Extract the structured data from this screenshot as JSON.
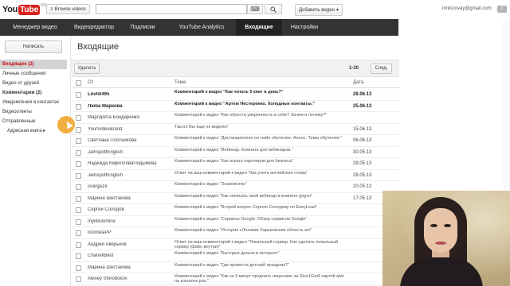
{
  "masthead": {
    "logo_you": "You",
    "logo_tube": "Tube",
    "logo_region": "RU",
    "browse_label": "Browse videos",
    "search_placeholder": "",
    "upload_label": "Добавить видео",
    "username": "irinlozovay@gmail.com",
    "notification_count": "2"
  },
  "nav": {
    "tabs": [
      {
        "label": "Менеджер видео",
        "active": false
      },
      {
        "label": "Видеоредактор",
        "active": false
      },
      {
        "label": "Подписки",
        "active": false
      },
      {
        "label": "YouTube Analytics",
        "active": false
      },
      {
        "label": "Входящие",
        "active": true
      },
      {
        "label": "Настройки",
        "active": false
      }
    ]
  },
  "sidebar": {
    "compose_label": "Написать",
    "items": [
      {
        "label": "Входящие (2)",
        "state": "active"
      },
      {
        "label": "Личные сообщения",
        "state": ""
      },
      {
        "label": "Видео от друзей",
        "state": ""
      },
      {
        "label": "Комментарии (2)",
        "state": "bold"
      },
      {
        "label": "Уведомления в контактах",
        "state": ""
      },
      {
        "label": "Видеоответы",
        "state": ""
      },
      {
        "label": "Отправленные",
        "state": ""
      },
      {
        "label": "Адресная книга ▸",
        "state": "sub"
      }
    ]
  },
  "main": {
    "title": "Входящие",
    "delete_label": "Удалить",
    "range": "1-20",
    "next_label": "След.",
    "columns": {
      "from": "От",
      "subject": "Тема",
      "date": "Дата"
    },
    "rows": [
      {
        "from": "Lovlili495",
        "subject": "Комментарий к видео \"Как читать 5 книг в день?\"",
        "date": "28.06.13",
        "unread": true
      },
      {
        "from": "Люба Маркова",
        "subject": "Комментарий к видео \"Артем Нестеренко. Холодные контакты.\"",
        "date": "25.06.13",
        "unread": true
      },
      {
        "from": "Маргарита Бондаренко",
        "subject": "Комментарий к видео \"Как обрести уверенность в себе? Зачем и почему?\"",
        "date": "",
        "unread": false
      },
      {
        "from": "YourVideoBrand",
        "subject": "Такого Вы еще не видели!",
        "date": "15.06.13",
        "unread": false
      },
      {
        "from": "Светлана Плотникова",
        "subject": "Комментарий к видео \"Дистанционное он-лайн обучение. Анонс. Темы обучения.\"",
        "date": "06.06.13",
        "unread": false
      },
      {
        "from": "JamspottEnglish",
        "subject": "Комментарий к видео \"Вебинар. Комната для вебинаров.\"",
        "date": "30.05.13",
        "unread": false
      },
      {
        "from": "Надежда КирилловаПодымова",
        "subject": "Комментарий к видео \"Как искать партнеров для бизнеса\"",
        "date": "29.05.13",
        "unread": false
      },
      {
        "from": "JamspottEnglish",
        "subject": "Ответ на ваш комментарий к видео \"Как учить английские слова\"",
        "date": "28.05.13",
        "unread": false
      },
      {
        "from": "svarga16",
        "subject": "Комментарий к видео \"Знакомство\"",
        "date": "20.05.13",
        "unread": false
      },
      {
        "from": "Марина Шестакова",
        "subject": "Комментарий к видео \"Как записать свой вебинар в комнате gogvo\"",
        "date": "17.05.13",
        "unread": false
      },
      {
        "from": "Сергей Солодов",
        "subject": "Комментарий к видео \"Второй вопрос Сергею Солодову по EasyLead\"",
        "date": "",
        "unread": false
      },
      {
        "from": "mylife3online",
        "subject": "Комментарий к видео \"Сервисы Google. Обзор сервисов Google\"",
        "date": "",
        "unread": false
      },
      {
        "from": "lozivskaPP",
        "subject": "Комментарий к видео \"История г.Лозовая Харьковская область.avi\"",
        "date": "",
        "unread": false
      },
      {
        "from": "Андрей Аверьков",
        "subject": "Ответ на ваш комментарий к видео \"Локальный сервер. Как сделать локальный сервер (файл внутри)\"",
        "date": "",
        "unread": false
      },
      {
        "from": "ChanellBest",
        "subject": "Комментарий к видео \"Быстрые деньги в интернет\"",
        "date": "",
        "unread": false
      },
      {
        "from": "Марина Шестакова",
        "subject": "Комментарий к видео \"Где провести детский праздник?\"",
        "date": "",
        "unread": false
      },
      {
        "from": "Alexey Shirobokov",
        "subject": "Комментарий к видео \"Как за 5 минут продлить лицензию за Give1Get4 картой qiwi на кошелек раз.\"",
        "date": "",
        "unread": false
      }
    ]
  },
  "colors": {
    "accent_red": "#d8221e",
    "nav_bg": "#333333",
    "active_sidebar_text": "#cc1111",
    "cursor_highlight": "#f0a020"
  }
}
